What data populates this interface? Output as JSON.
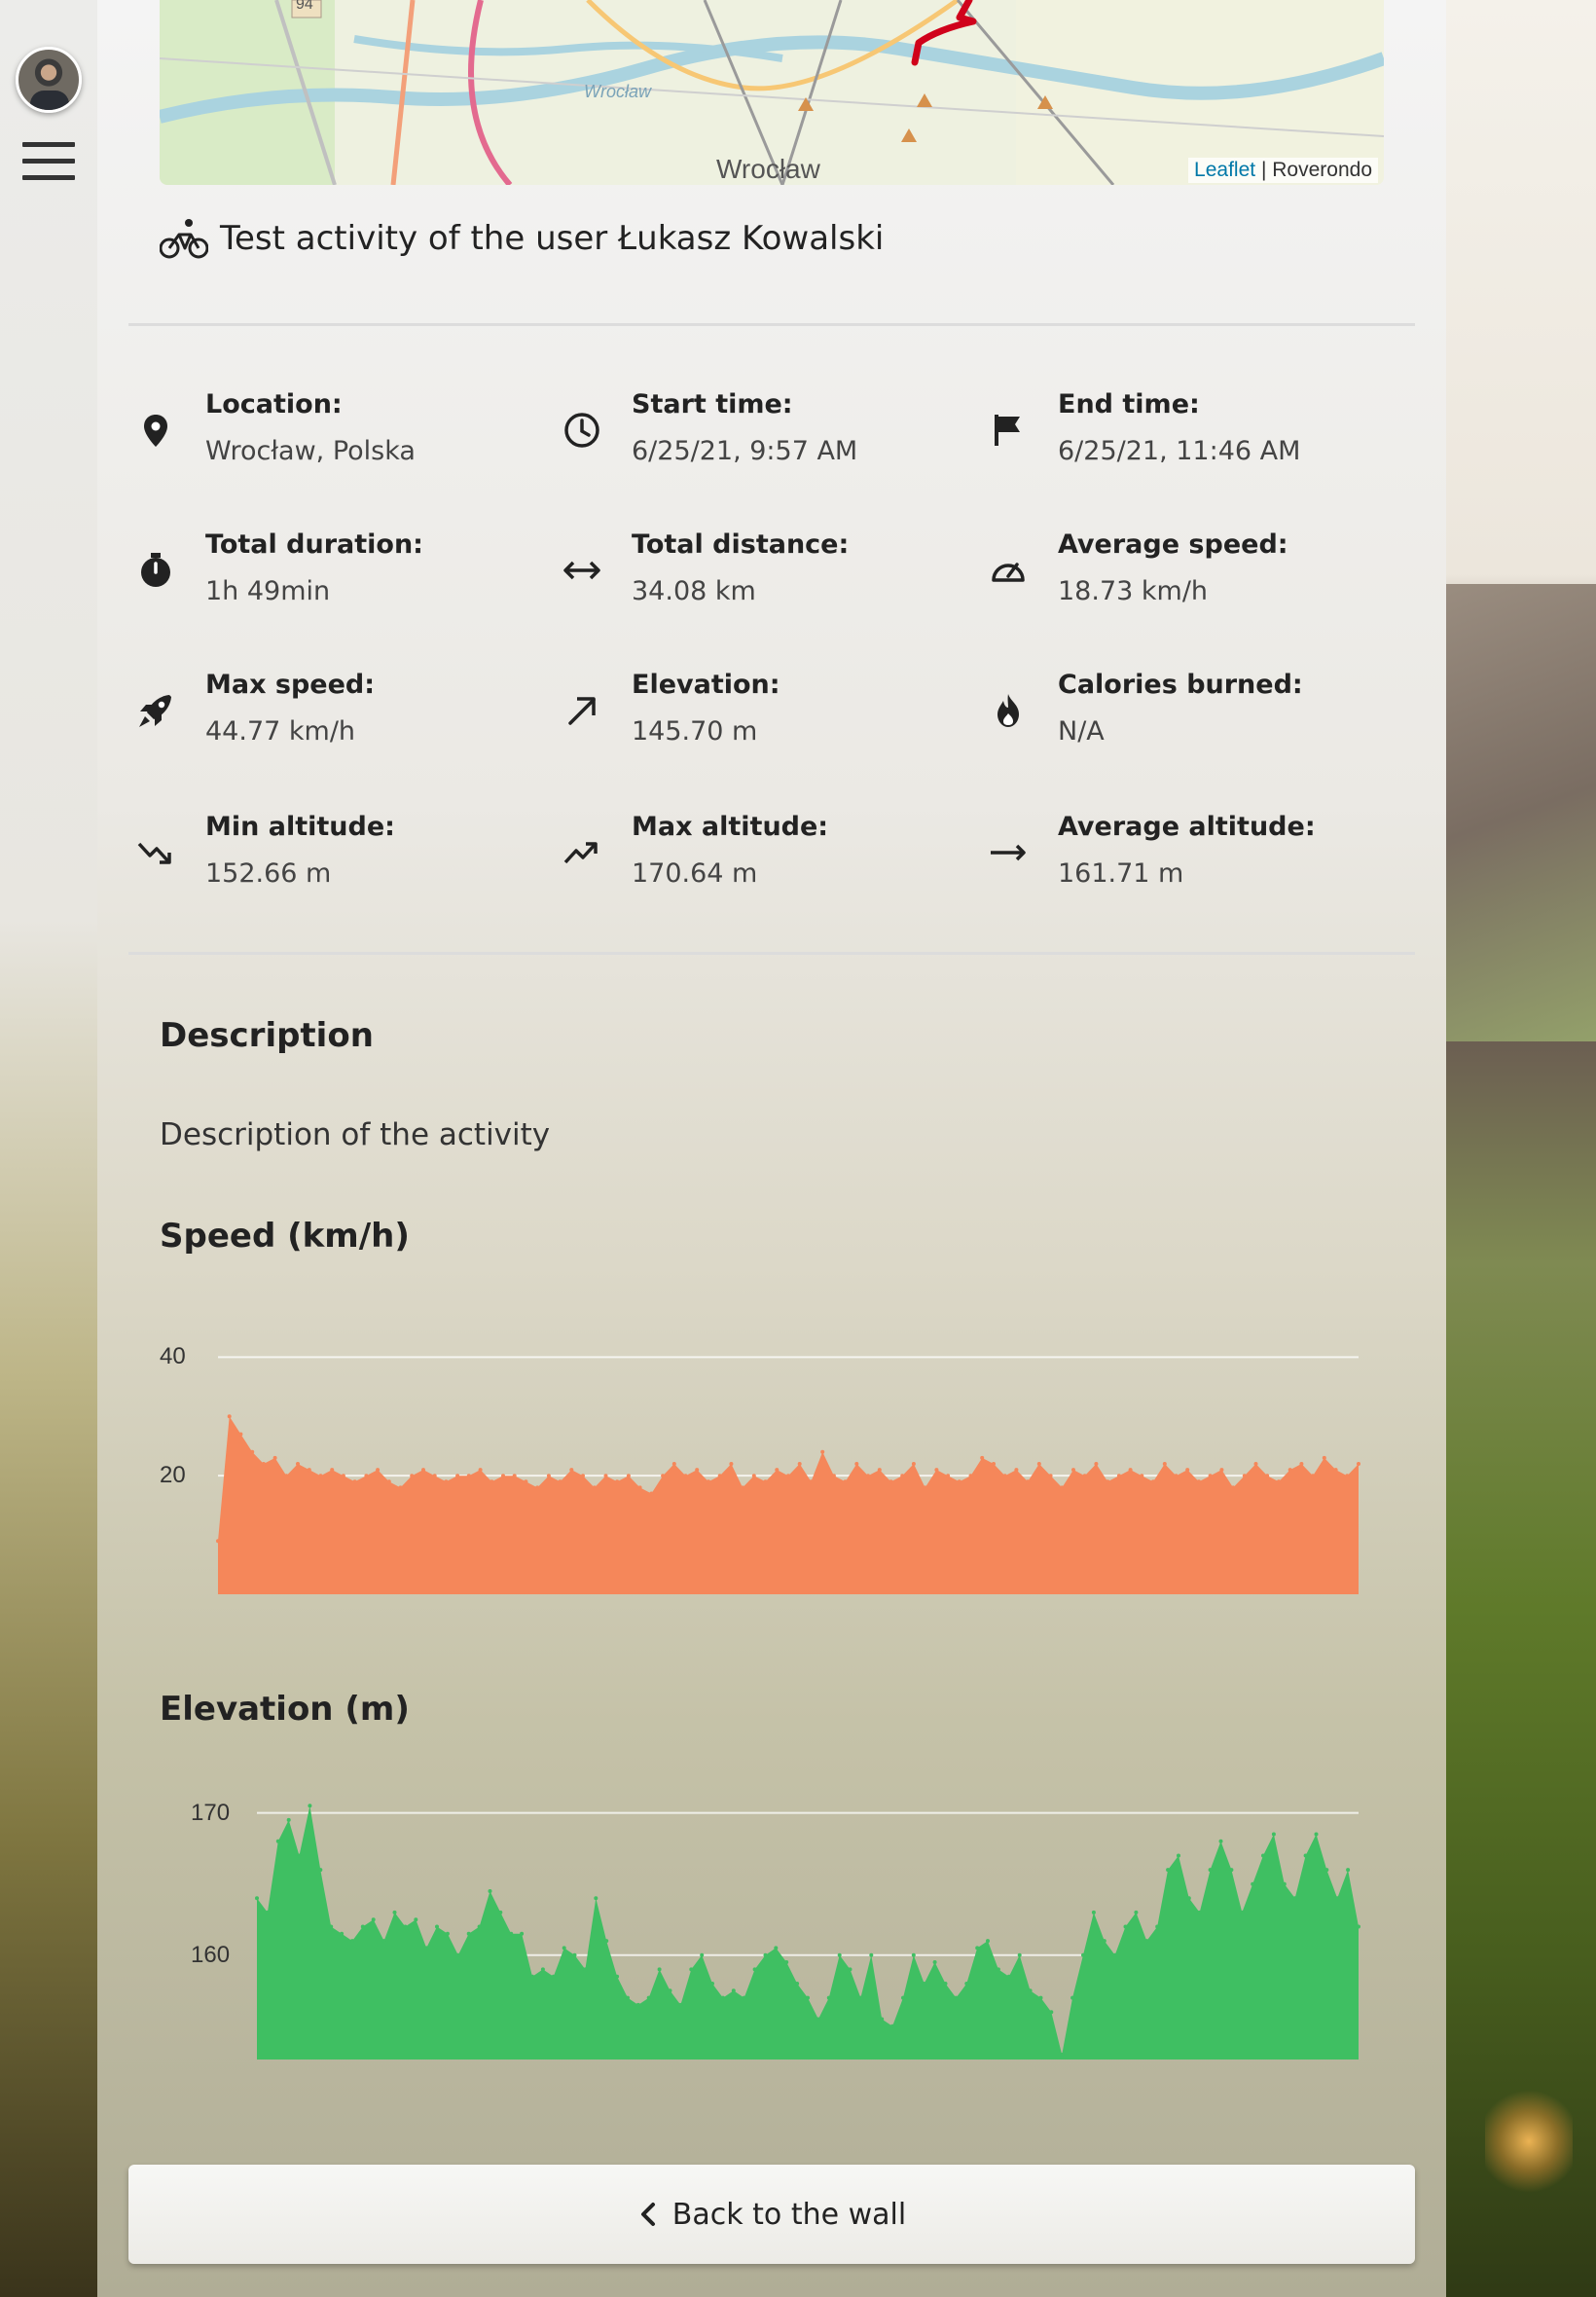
{
  "map": {
    "attribution_leaflet": "Leaflet",
    "attribution_separator": "|",
    "attribution_provider": "Roverondo",
    "labels": {
      "city_main": "Wrocław",
      "city_small": "Wrocław",
      "road_number": "94"
    }
  },
  "activity": {
    "title": "Test activity of the user Łukasz Kowalski",
    "type_icon": "bicycle-icon"
  },
  "stats": [
    {
      "label": "Location:",
      "value": "Wrocław, Polska",
      "icon": "location-pin-icon"
    },
    {
      "label": "Start time:",
      "value": "6/25/21, 9:57 AM",
      "icon": "clock-icon"
    },
    {
      "label": "End time:",
      "value": "6/25/21, 11:46 AM",
      "icon": "flag-icon"
    },
    {
      "label": "Total duration:",
      "value": "1h 49min",
      "icon": "stopwatch-icon"
    },
    {
      "label": "Total distance:",
      "value": "34.08 km",
      "icon": "arrows-horizontal-icon"
    },
    {
      "label": "Average speed:",
      "value": "18.73 km/h",
      "icon": "speedometer-icon"
    },
    {
      "label": "Max speed:",
      "value": "44.77 km/h",
      "icon": "rocket-icon"
    },
    {
      "label": "Elevation:",
      "value": "145.70 m",
      "icon": "arrow-up-right-icon"
    },
    {
      "label": "Calories burned:",
      "value": "N/A",
      "icon": "fire-icon"
    },
    {
      "label": "Min altitude:",
      "value": "152.66 m",
      "icon": "trend-down-icon"
    },
    {
      "label": "Max altitude:",
      "value": "170.64 m",
      "icon": "trend-up-icon"
    },
    {
      "label": "Average altitude:",
      "value": "161.71 m",
      "icon": "arrow-right-icon"
    }
  ],
  "description": {
    "heading": "Description",
    "text": "Description of the activity"
  },
  "charts": {
    "speed_title": "Speed (km/h)",
    "elevation_title": "Elevation (m)"
  },
  "chart_data": [
    {
      "type": "area",
      "title": "Speed (km/h)",
      "ylim": [
        0,
        44
      ],
      "yticks": [
        20,
        40
      ],
      "color": "#f5875a",
      "x_index_max": 100,
      "values": [
        9,
        30,
        27,
        24,
        22,
        23,
        20,
        22,
        21,
        20,
        21,
        20,
        19,
        20,
        21,
        19,
        18,
        20,
        21,
        20,
        19,
        20,
        20,
        21,
        19,
        20,
        20,
        19,
        18,
        20,
        19,
        21,
        20,
        18,
        20,
        19,
        20,
        18,
        17,
        20,
        22,
        20,
        21,
        19,
        20,
        22,
        18,
        20,
        19,
        21,
        20,
        22,
        19,
        24,
        20,
        19,
        22,
        20,
        21,
        19,
        20,
        22,
        18,
        21,
        20,
        19,
        20,
        23,
        22,
        20,
        21,
        19,
        22,
        20,
        18,
        21,
        20,
        22,
        19,
        20,
        21,
        20,
        19,
        22,
        20,
        21,
        19,
        20,
        21,
        18,
        20,
        22,
        20,
        19,
        21,
        22,
        20,
        23,
        21,
        20,
        22
      ]
    },
    {
      "type": "area",
      "title": "Elevation (m)",
      "ylim": [
        152.66,
        171
      ],
      "yticks": [
        160,
        170
      ],
      "color": "#3fbf62",
      "x_index_max": 100,
      "values": [
        164,
        163,
        168,
        169.5,
        167,
        170.5,
        166,
        162,
        161.5,
        161,
        162,
        162.5,
        161,
        163,
        162,
        162.5,
        160.5,
        162,
        161.5,
        160,
        161.5,
        162,
        164.5,
        163,
        161.5,
        161.5,
        158.5,
        159,
        158.5,
        160.5,
        160,
        159,
        164,
        161,
        158.5,
        157,
        156.5,
        157,
        159,
        157.5,
        156.5,
        159,
        160,
        158,
        157,
        157.5,
        157,
        159,
        160,
        160.5,
        159.5,
        158,
        157,
        155.5,
        157,
        160,
        159,
        157,
        160,
        155.5,
        155,
        157,
        160,
        158,
        159.5,
        158,
        157,
        158,
        160.5,
        161,
        159,
        158.5,
        160,
        157.5,
        157,
        156,
        153,
        157,
        160,
        163,
        161,
        160,
        162,
        163,
        161,
        162,
        166,
        167,
        164,
        163,
        166,
        168,
        166,
        163,
        165,
        167,
        168.5,
        165,
        164,
        167,
        168.5,
        166,
        164,
        166,
        162
      ]
    }
  ],
  "back_button": {
    "label": "Back to the wall",
    "icon": "chevron-left-icon"
  }
}
